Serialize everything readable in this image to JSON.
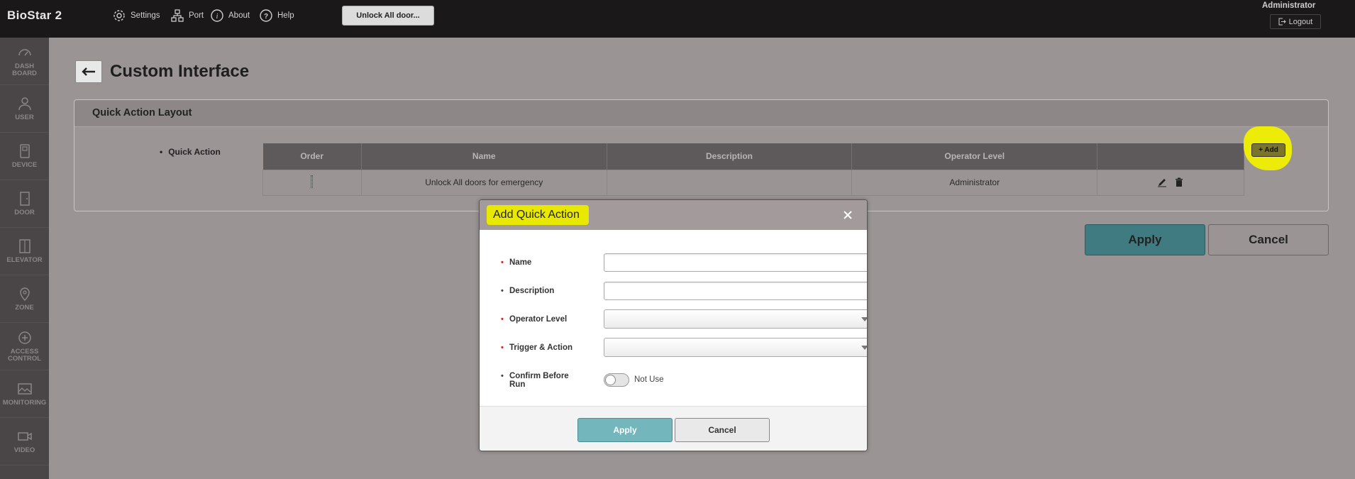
{
  "app": {
    "brand": "BioStar 2"
  },
  "topnav": {
    "settings": "Settings",
    "port": "Port",
    "about": "About",
    "help": "Help",
    "unlock_button": "Unlock All door..."
  },
  "user": {
    "name": "Administrator",
    "logout": "Logout"
  },
  "sidebar": {
    "items": [
      {
        "label": "DASH BOARD",
        "icon": "dashboard-icon"
      },
      {
        "label": "USER",
        "icon": "user-icon"
      },
      {
        "label": "DEVICE",
        "icon": "device-icon"
      },
      {
        "label": "DOOR",
        "icon": "door-icon"
      },
      {
        "label": "ELEVATOR",
        "icon": "elevator-icon"
      },
      {
        "label": "ZONE",
        "icon": "zone-icon"
      },
      {
        "label": "ACCESS CONTROL",
        "icon": "access-control-icon"
      },
      {
        "label": "MONITORING",
        "icon": "monitoring-icon"
      },
      {
        "label": "VIDEO",
        "icon": "video-icon"
      }
    ]
  },
  "page": {
    "title": "Custom Interface"
  },
  "panel": {
    "title": "Quick Action Layout",
    "field_label": "Quick Action",
    "add_button": "+ Add",
    "columns": [
      "Order",
      "Name",
      "Description",
      "Operator Level",
      ""
    ],
    "rows": [
      {
        "name": "Unlock All doors for emergency",
        "description": "",
        "operator_level": "Administrator"
      }
    ]
  },
  "page_buttons": {
    "apply": "Apply",
    "cancel": "Cancel"
  },
  "modal": {
    "title": "Add Quick Action",
    "fields": {
      "name": {
        "label": "Name",
        "value": ""
      },
      "description": {
        "label": "Description",
        "value": ""
      },
      "operator_level": {
        "label": "Operator Level",
        "value": ""
      },
      "trigger_action": {
        "label": "Trigger & Action",
        "value": ""
      },
      "confirm": {
        "label": "Confirm Before Run",
        "state": "Not Use"
      }
    },
    "apply": "Apply",
    "cancel": "Cancel"
  },
  "colors": {
    "highlight": "#f0f000",
    "apply_teal": "#3f7b80",
    "modal_apply": "#73b7bd",
    "required_bullet": "#dd2222"
  }
}
